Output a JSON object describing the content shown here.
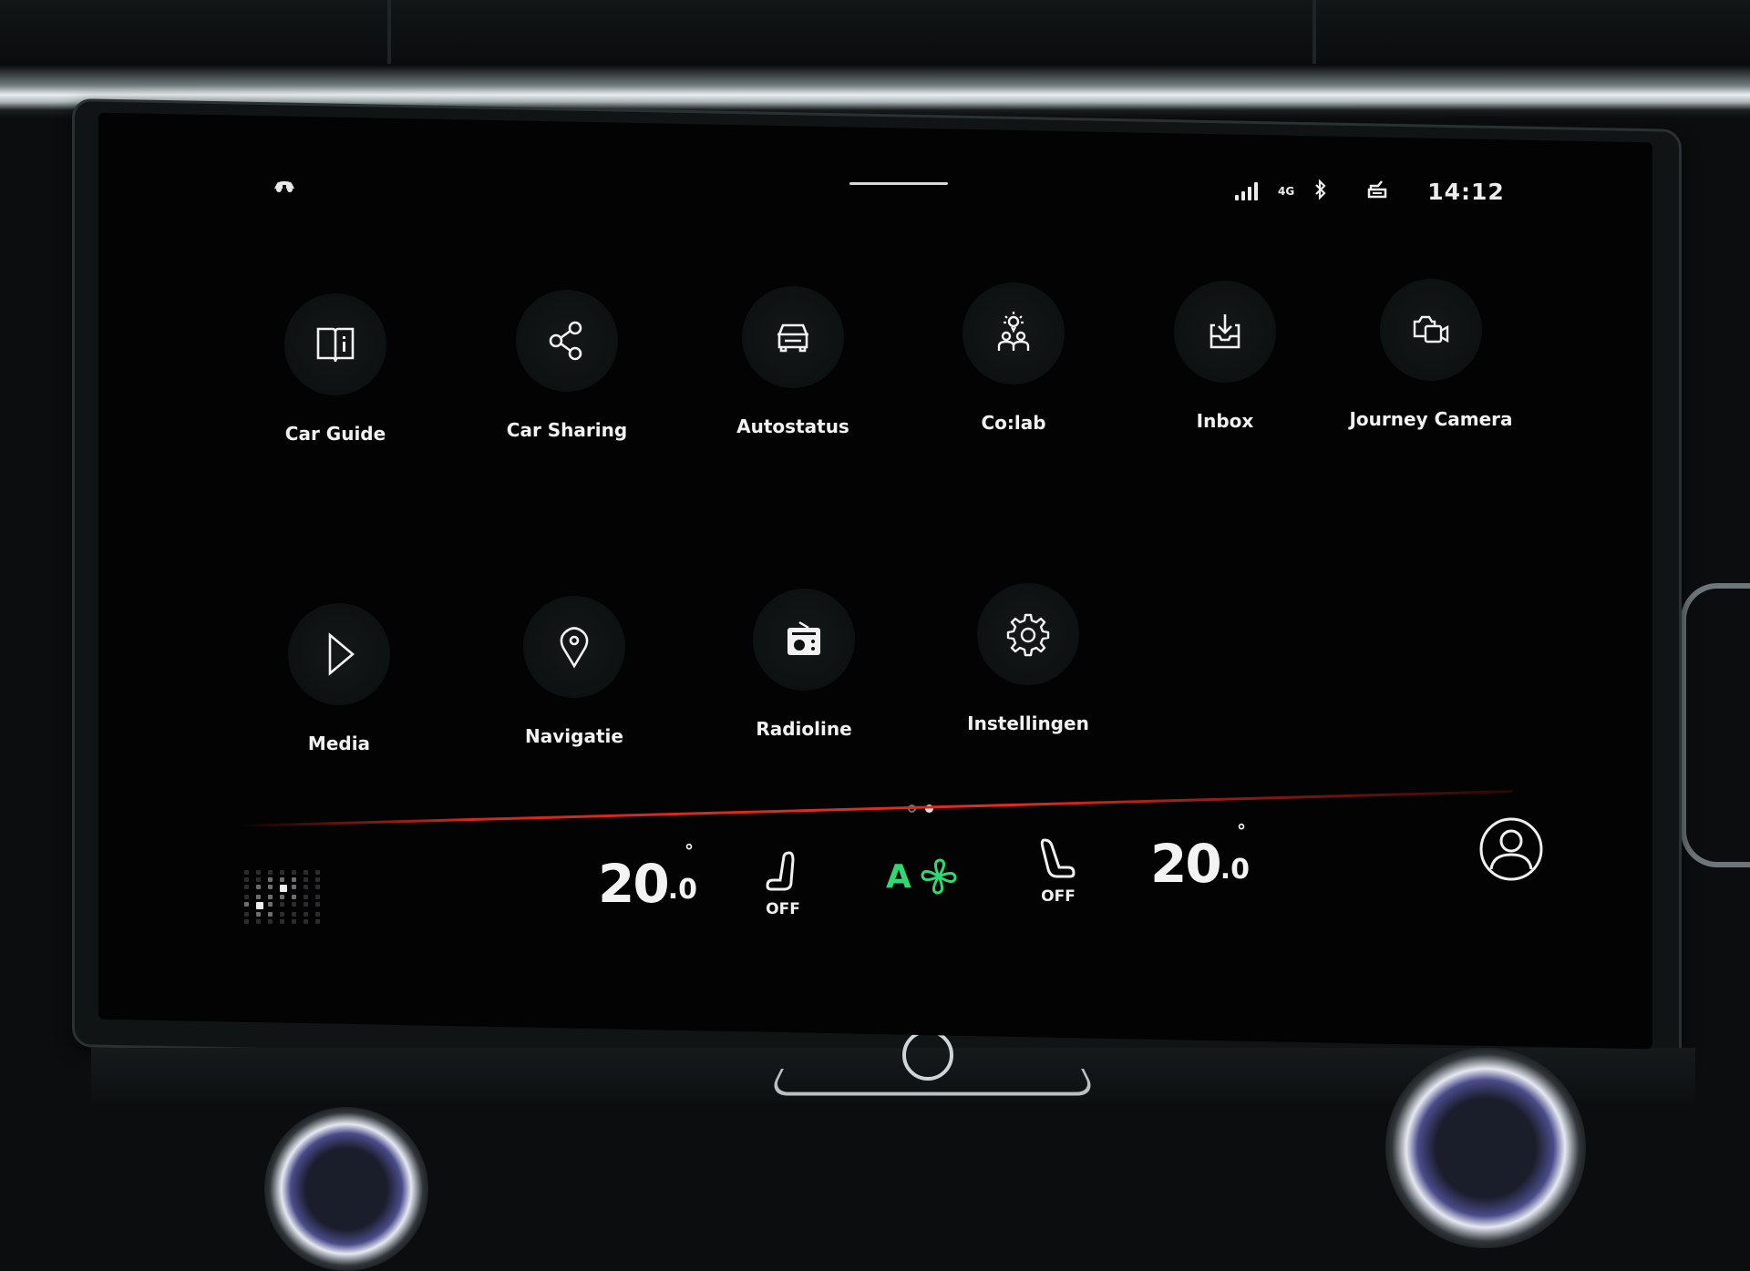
{
  "status_bar": {
    "left_icon": "vehicle-connected-icon",
    "signal_icon": "cellular-signal-icon",
    "network": "4G",
    "bluetooth_icon": "bluetooth-icon",
    "driver_icon": "seat-driver-icon",
    "time": "14:12"
  },
  "apps": [
    {
      "label": "Car Guide",
      "icon": "book-info-icon"
    },
    {
      "label": "Car Sharing",
      "icon": "share-icon"
    },
    {
      "label": "Autostatus",
      "icon": "car-front-icon"
    },
    {
      "label": "Co:lab",
      "icon": "lightbulb-people-icon"
    },
    {
      "label": "Inbox",
      "icon": "inbox-download-icon"
    },
    {
      "label": "Journey Camera",
      "icon": "camera-video-icon"
    },
    {
      "label": "Media",
      "icon": "play-icon"
    },
    {
      "label": "Navigatie",
      "icon": "location-pin-icon"
    },
    {
      "label": "Radioline",
      "icon": "radio-icon"
    },
    {
      "label": "Instellingen",
      "icon": "gear-icon"
    }
  ],
  "pager": {
    "pages": 2,
    "current": 2
  },
  "climate": {
    "driver_temp": {
      "int": "20",
      "dec": "0",
      "unit": "°"
    },
    "driver_seat_heat": "OFF",
    "fan_mode": "A",
    "fan_color": "#2fd873",
    "passenger_seat_heat": "OFF",
    "passenger_temp": {
      "int": "20",
      "dec": "0",
      "unit": "°"
    }
  },
  "accent_color": "#e52b23"
}
